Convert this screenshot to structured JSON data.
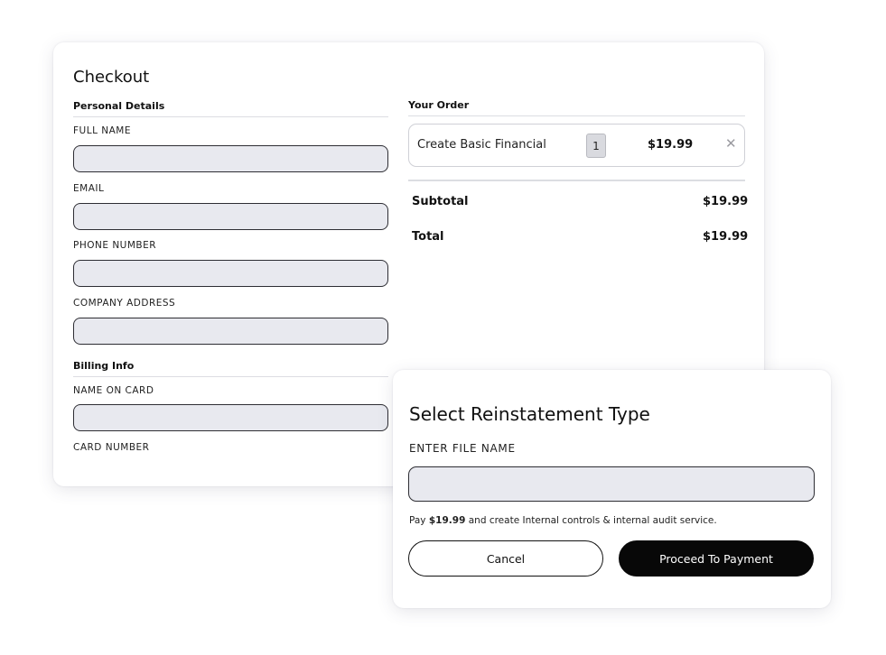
{
  "checkout": {
    "title": "Checkout",
    "personal_details": {
      "heading": "Personal Details",
      "fields": [
        {
          "label": "FULL NAME",
          "value": ""
        },
        {
          "label": "EMAIL",
          "value": ""
        },
        {
          "label": "PHONE NUMBER",
          "value": ""
        },
        {
          "label": "COMPANY ADDRESS",
          "value": ""
        }
      ]
    },
    "billing_info": {
      "heading": "Billing Info",
      "fields": [
        {
          "label": "NAME ON CARD",
          "value": ""
        },
        {
          "label": "CARD NUMBER",
          "value": ""
        }
      ]
    },
    "order": {
      "heading": "Your Order",
      "items": [
        {
          "name": "Create Basic Financial",
          "quantity": "1",
          "price": "$19.99",
          "remove_icon": "close-icon",
          "remove_glyph": "✕"
        }
      ],
      "subtotal_label": "Subtotal",
      "subtotal_value": "$19.99",
      "total_label": "Total",
      "total_value": "$19.99"
    }
  },
  "modal": {
    "title": "Select Reinstatement Type",
    "file_name_label": "ENTER FILE NAME",
    "file_name_value": "",
    "note_prefix": "Pay",
    "note_amount": "$19.99",
    "note_suffix": "and create Internal controls & internal audit service.",
    "cancel_label": "Cancel",
    "proceed_label": "Proceed To Payment"
  },
  "colors": {
    "input_fill": "#e8e9ef",
    "input_border": "#2d2d33",
    "primary_button": "#080808",
    "divider": "#dcdde2"
  }
}
